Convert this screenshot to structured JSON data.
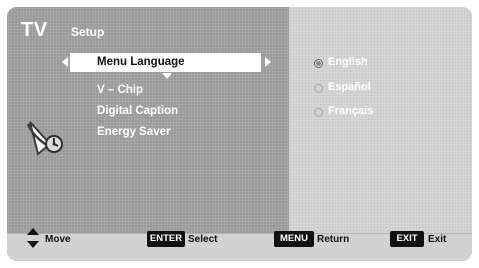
{
  "header": {
    "title": "TV",
    "section": "Setup"
  },
  "menu": {
    "items": [
      {
        "label": "Menu Language",
        "selected": true
      },
      {
        "label": "V – Chip",
        "selected": false
      },
      {
        "label": "Digital Caption",
        "selected": false
      },
      {
        "label": "Energy Saver",
        "selected": false
      }
    ]
  },
  "options": [
    {
      "label": "English",
      "selected": true
    },
    {
      "label": "Español",
      "selected": false
    },
    {
      "label": "Français",
      "selected": false
    }
  ],
  "footer": {
    "move_label": "Move",
    "enter_key": "ENTER",
    "enter_label": "Select",
    "menu_key": "MENU",
    "menu_label": "Return",
    "exit_key": "EXIT",
    "exit_label": "Exit"
  },
  "icons": {
    "tv_setup": "satellite-dish-icon",
    "updown": "up-down-arrow-icon"
  },
  "colors": {
    "left_panel": "#9a9a9a",
    "right_panel": "#d6d6d6",
    "highlight": "#ffffff",
    "key_bg": "#111111"
  }
}
